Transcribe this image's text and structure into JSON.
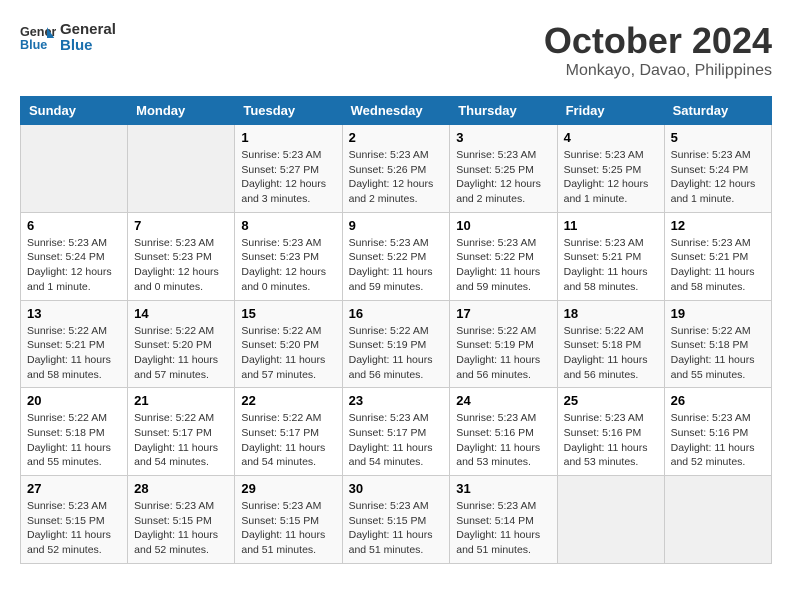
{
  "header": {
    "logo_line1": "General",
    "logo_line2": "Blue",
    "month": "October 2024",
    "location": "Monkayo, Davao, Philippines"
  },
  "days_of_week": [
    "Sunday",
    "Monday",
    "Tuesday",
    "Wednesday",
    "Thursday",
    "Friday",
    "Saturday"
  ],
  "weeks": [
    [
      {
        "num": "",
        "sunrise": "",
        "sunset": "",
        "daylight": "",
        "empty": true
      },
      {
        "num": "",
        "sunrise": "",
        "sunset": "",
        "daylight": "",
        "empty": true
      },
      {
        "num": "1",
        "sunrise": "Sunrise: 5:23 AM",
        "sunset": "Sunset: 5:27 PM",
        "daylight": "Daylight: 12 hours and 3 minutes."
      },
      {
        "num": "2",
        "sunrise": "Sunrise: 5:23 AM",
        "sunset": "Sunset: 5:26 PM",
        "daylight": "Daylight: 12 hours and 2 minutes."
      },
      {
        "num": "3",
        "sunrise": "Sunrise: 5:23 AM",
        "sunset": "Sunset: 5:25 PM",
        "daylight": "Daylight: 12 hours and 2 minutes."
      },
      {
        "num": "4",
        "sunrise": "Sunrise: 5:23 AM",
        "sunset": "Sunset: 5:25 PM",
        "daylight": "Daylight: 12 hours and 1 minute."
      },
      {
        "num": "5",
        "sunrise": "Sunrise: 5:23 AM",
        "sunset": "Sunset: 5:24 PM",
        "daylight": "Daylight: 12 hours and 1 minute."
      }
    ],
    [
      {
        "num": "6",
        "sunrise": "Sunrise: 5:23 AM",
        "sunset": "Sunset: 5:24 PM",
        "daylight": "Daylight: 12 hours and 1 minute."
      },
      {
        "num": "7",
        "sunrise": "Sunrise: 5:23 AM",
        "sunset": "Sunset: 5:23 PM",
        "daylight": "Daylight: 12 hours and 0 minutes."
      },
      {
        "num": "8",
        "sunrise": "Sunrise: 5:23 AM",
        "sunset": "Sunset: 5:23 PM",
        "daylight": "Daylight: 12 hours and 0 minutes."
      },
      {
        "num": "9",
        "sunrise": "Sunrise: 5:23 AM",
        "sunset": "Sunset: 5:22 PM",
        "daylight": "Daylight: 11 hours and 59 minutes."
      },
      {
        "num": "10",
        "sunrise": "Sunrise: 5:23 AM",
        "sunset": "Sunset: 5:22 PM",
        "daylight": "Daylight: 11 hours and 59 minutes."
      },
      {
        "num": "11",
        "sunrise": "Sunrise: 5:23 AM",
        "sunset": "Sunset: 5:21 PM",
        "daylight": "Daylight: 11 hours and 58 minutes."
      },
      {
        "num": "12",
        "sunrise": "Sunrise: 5:23 AM",
        "sunset": "Sunset: 5:21 PM",
        "daylight": "Daylight: 11 hours and 58 minutes."
      }
    ],
    [
      {
        "num": "13",
        "sunrise": "Sunrise: 5:22 AM",
        "sunset": "Sunset: 5:21 PM",
        "daylight": "Daylight: 11 hours and 58 minutes."
      },
      {
        "num": "14",
        "sunrise": "Sunrise: 5:22 AM",
        "sunset": "Sunset: 5:20 PM",
        "daylight": "Daylight: 11 hours and 57 minutes."
      },
      {
        "num": "15",
        "sunrise": "Sunrise: 5:22 AM",
        "sunset": "Sunset: 5:20 PM",
        "daylight": "Daylight: 11 hours and 57 minutes."
      },
      {
        "num": "16",
        "sunrise": "Sunrise: 5:22 AM",
        "sunset": "Sunset: 5:19 PM",
        "daylight": "Daylight: 11 hours and 56 minutes."
      },
      {
        "num": "17",
        "sunrise": "Sunrise: 5:22 AM",
        "sunset": "Sunset: 5:19 PM",
        "daylight": "Daylight: 11 hours and 56 minutes."
      },
      {
        "num": "18",
        "sunrise": "Sunrise: 5:22 AM",
        "sunset": "Sunset: 5:18 PM",
        "daylight": "Daylight: 11 hours and 56 minutes."
      },
      {
        "num": "19",
        "sunrise": "Sunrise: 5:22 AM",
        "sunset": "Sunset: 5:18 PM",
        "daylight": "Daylight: 11 hours and 55 minutes."
      }
    ],
    [
      {
        "num": "20",
        "sunrise": "Sunrise: 5:22 AM",
        "sunset": "Sunset: 5:18 PM",
        "daylight": "Daylight: 11 hours and 55 minutes."
      },
      {
        "num": "21",
        "sunrise": "Sunrise: 5:22 AM",
        "sunset": "Sunset: 5:17 PM",
        "daylight": "Daylight: 11 hours and 54 minutes."
      },
      {
        "num": "22",
        "sunrise": "Sunrise: 5:22 AM",
        "sunset": "Sunset: 5:17 PM",
        "daylight": "Daylight: 11 hours and 54 minutes."
      },
      {
        "num": "23",
        "sunrise": "Sunrise: 5:23 AM",
        "sunset": "Sunset: 5:17 PM",
        "daylight": "Daylight: 11 hours and 54 minutes."
      },
      {
        "num": "24",
        "sunrise": "Sunrise: 5:23 AM",
        "sunset": "Sunset: 5:16 PM",
        "daylight": "Daylight: 11 hours and 53 minutes."
      },
      {
        "num": "25",
        "sunrise": "Sunrise: 5:23 AM",
        "sunset": "Sunset: 5:16 PM",
        "daylight": "Daylight: 11 hours and 53 minutes."
      },
      {
        "num": "26",
        "sunrise": "Sunrise: 5:23 AM",
        "sunset": "Sunset: 5:16 PM",
        "daylight": "Daylight: 11 hours and 52 minutes."
      }
    ],
    [
      {
        "num": "27",
        "sunrise": "Sunrise: 5:23 AM",
        "sunset": "Sunset: 5:15 PM",
        "daylight": "Daylight: 11 hours and 52 minutes."
      },
      {
        "num": "28",
        "sunrise": "Sunrise: 5:23 AM",
        "sunset": "Sunset: 5:15 PM",
        "daylight": "Daylight: 11 hours and 52 minutes."
      },
      {
        "num": "29",
        "sunrise": "Sunrise: 5:23 AM",
        "sunset": "Sunset: 5:15 PM",
        "daylight": "Daylight: 11 hours and 51 minutes."
      },
      {
        "num": "30",
        "sunrise": "Sunrise: 5:23 AM",
        "sunset": "Sunset: 5:15 PM",
        "daylight": "Daylight: 11 hours and 51 minutes."
      },
      {
        "num": "31",
        "sunrise": "Sunrise: 5:23 AM",
        "sunset": "Sunset: 5:14 PM",
        "daylight": "Daylight: 11 hours and 51 minutes."
      },
      {
        "num": "",
        "sunrise": "",
        "sunset": "",
        "daylight": "",
        "empty": true
      },
      {
        "num": "",
        "sunrise": "",
        "sunset": "",
        "daylight": "",
        "empty": true
      }
    ]
  ]
}
